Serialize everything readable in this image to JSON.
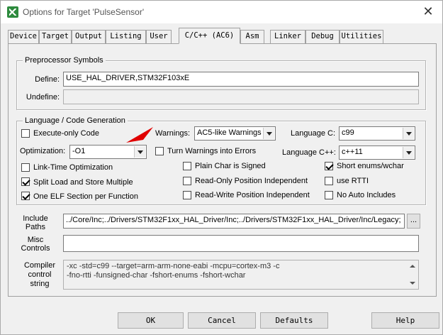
{
  "window": {
    "title": "Options for Target 'PulseSensor'"
  },
  "tabs": [
    {
      "label": "Device"
    },
    {
      "label": "Target"
    },
    {
      "label": "Output"
    },
    {
      "label": "Listing"
    },
    {
      "label": "User"
    },
    {
      "label": "C/C++ (AC6)"
    },
    {
      "label": "Asm"
    },
    {
      "label": "Linker"
    },
    {
      "label": "Debug"
    },
    {
      "label": "Utilities"
    }
  ],
  "preprocessor": {
    "group_label": "Preprocessor Symbols",
    "define_label": "Define:",
    "define_value": "USE_HAL_DRIVER,STM32F103xE",
    "undefine_label": "Undefine:",
    "undefine_value": ""
  },
  "language": {
    "group_label": "Language / Code Generation",
    "execute_only": {
      "label": "Execute-only Code",
      "checked": false
    },
    "optimization_label": "Optimization:",
    "optimization_value": "-O1",
    "link_time": {
      "label": "Link-Time Optimization",
      "checked": false
    },
    "split_load": {
      "label": "Split Load and Store Multiple",
      "checked": true
    },
    "one_elf": {
      "label": "One ELF Section per Function",
      "checked": true
    },
    "warnings_label": "Warnings:",
    "warnings_value": "AC5-like Warnings",
    "turn_warnings": {
      "label": "Turn Warnings into Errors",
      "checked": false
    },
    "plain_char": {
      "label": "Plain Char is Signed",
      "checked": false
    },
    "ro_pi": {
      "label": "Read-Only Position Independent",
      "checked": false
    },
    "rw_pi": {
      "label": "Read-Write Position Independent",
      "checked": false
    },
    "language_c_label": "Language C:",
    "language_c_value": "c99",
    "language_cpp_label": "Language C++:",
    "language_cpp_value": "c++11",
    "short_enums": {
      "label": "Short enums/wchar",
      "checked": true
    },
    "use_rtti": {
      "label": "use RTTI",
      "checked": false
    },
    "no_auto_includes": {
      "label": "No Auto Includes",
      "checked": false
    }
  },
  "include": {
    "label_line1": "Include",
    "label_line2": "Paths",
    "value": "../Core/Inc;../Drivers/STM32F1xx_HAL_Driver/Inc;../Drivers/STM32F1xx_HAL_Driver/Inc/Legacy;",
    "browse_label": "..."
  },
  "misc": {
    "label_line1": "Misc",
    "label_line2": "Controls",
    "value": ""
  },
  "compiler": {
    "label_line1": "Compiler",
    "label_line2": "control",
    "label_line3": "string",
    "line1": "-xc -std=c99 --target=arm-arm-none-eabi -mcpu=cortex-m3 -c",
    "line2": "-fno-rtti -funsigned-char -fshort-enums -fshort-wchar"
  },
  "buttons": {
    "ok": "OK",
    "cancel": "Cancel",
    "defaults": "Defaults",
    "help": "Help"
  },
  "colors": {
    "annotation_arrow": "#e00000",
    "app_icon": "#2e8b3e"
  }
}
